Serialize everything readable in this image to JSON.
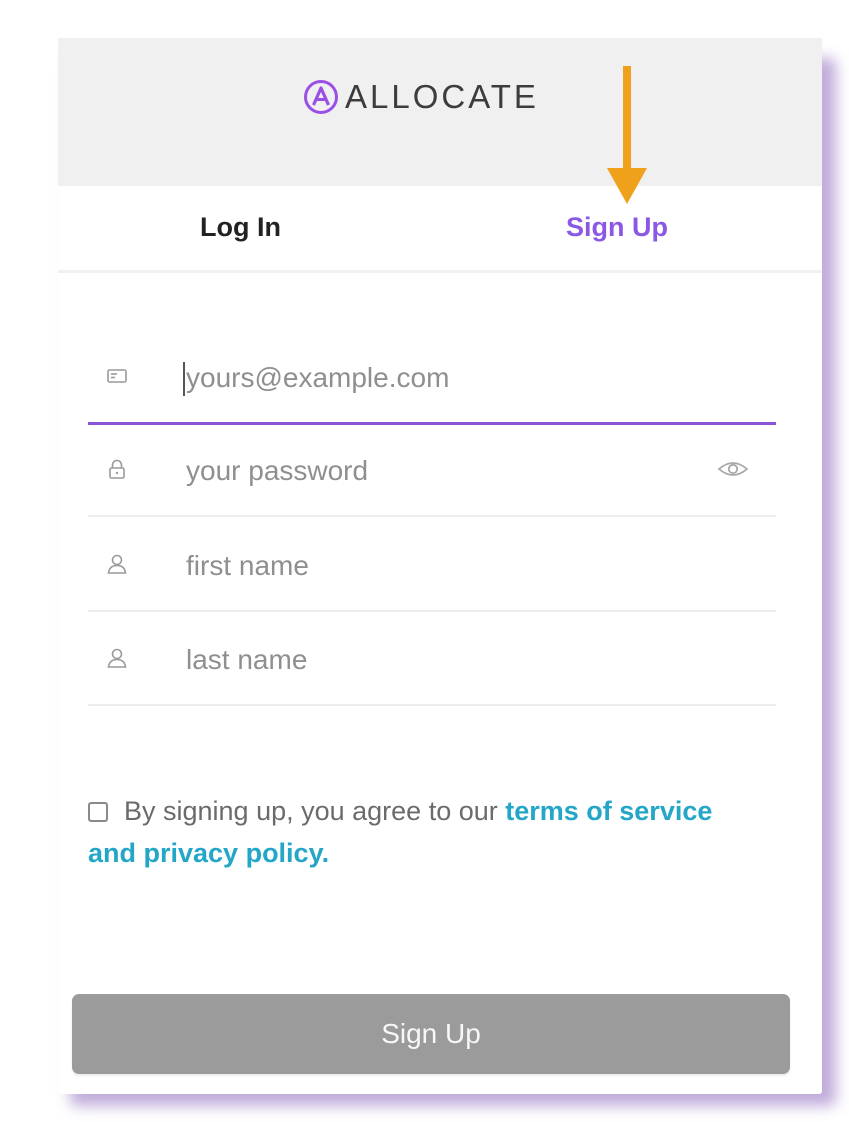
{
  "brand": {
    "name": "ALLOCATE",
    "accent_color": "#8b58e6"
  },
  "tabs": [
    {
      "label": "Log In",
      "active": false
    },
    {
      "label": "Sign Up",
      "active": true
    }
  ],
  "form": {
    "email": {
      "placeholder": "yours@example.com",
      "value": "",
      "icon": "email-icon"
    },
    "password": {
      "placeholder": "your password",
      "value": "",
      "icon": "lock-icon",
      "toggle_icon": "eye-icon"
    },
    "first_name": {
      "placeholder": "first name",
      "value": "",
      "icon": "user-icon"
    },
    "last_name": {
      "placeholder": "last name",
      "value": "",
      "icon": "user-icon"
    }
  },
  "agreement": {
    "checked": false,
    "text": "By signing up, you agree to our ",
    "link": "terms of service and privacy policy",
    "suffix": "."
  },
  "submit_label": "Sign Up",
  "annotation": {
    "icon": "arrow-down-icon",
    "color": "#f0a11c"
  }
}
